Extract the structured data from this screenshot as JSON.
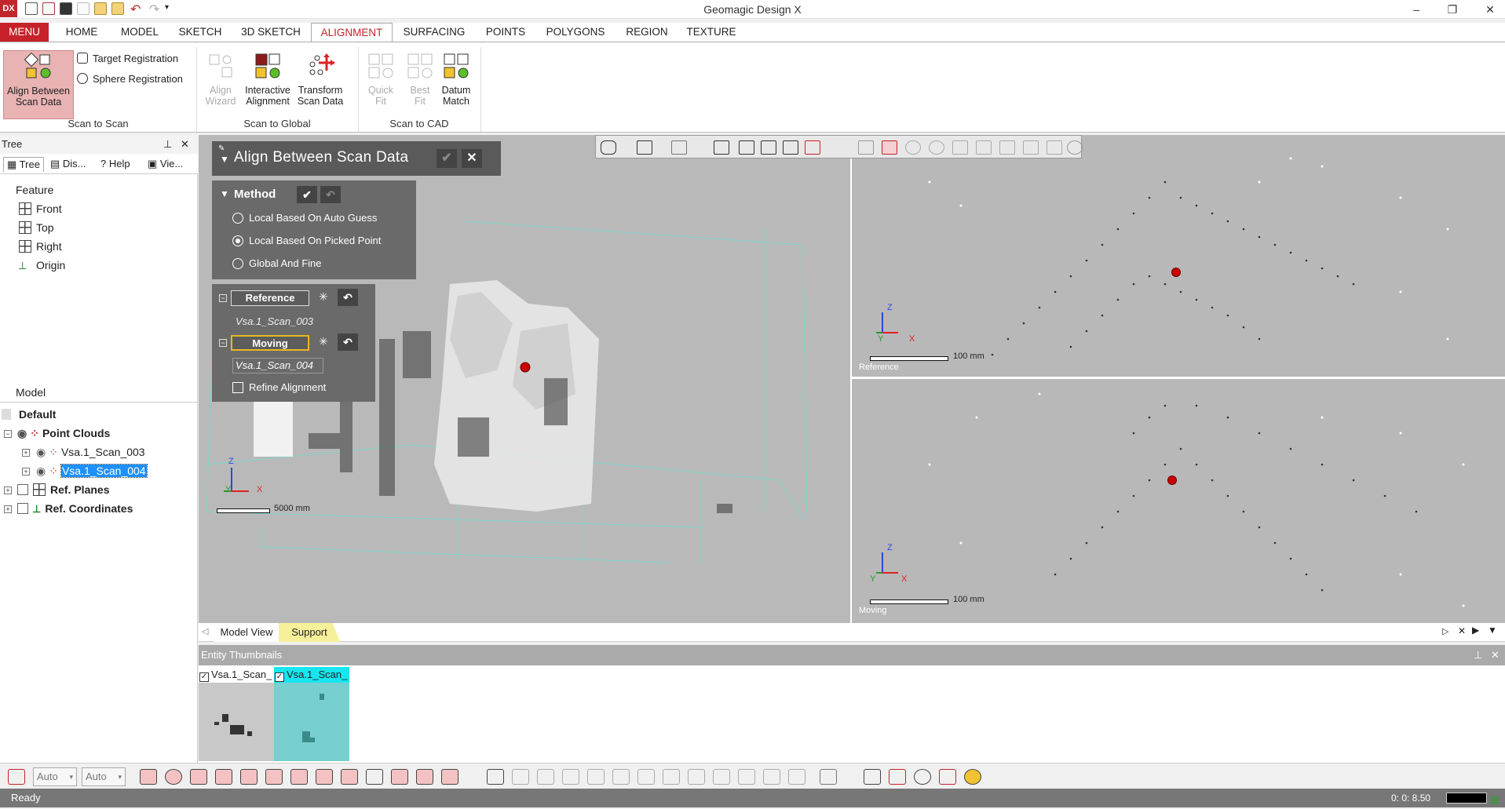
{
  "app": {
    "title": "Geomagic Design X",
    "logo_text": "DX"
  },
  "menu_tabs": [
    "MENU",
    "HOME",
    "MODEL",
    "SKETCH",
    "3D SKETCH",
    "ALIGNMENT",
    "SURFACING",
    "POINTS",
    "POLYGONS",
    "REGION",
    "TEXTURE"
  ],
  "ribbon": {
    "scan_to_scan": {
      "group_label": "Scan to Scan",
      "align_between": "Align Between\nScan Data",
      "target_registration": "Target Registration",
      "sphere_registration": "Sphere Registration"
    },
    "scan_to_global": {
      "group_label": "Scan to Global",
      "align_wizard": "Align\nWizard",
      "interactive_alignment": "Interactive\nAlignment",
      "transform_scan": "Transform\nScan Data"
    },
    "scan_to_cad": {
      "group_label": "Scan to CAD",
      "quick_fit": "Quick\nFit",
      "best_fit": "Best\nFit",
      "datum_match": "Datum\nMatch"
    }
  },
  "left_pane": {
    "header": "Tree",
    "tabs": [
      "Tree",
      "Dis...",
      "Help",
      "Vie..."
    ],
    "feature_label": "Feature",
    "features": [
      "Front",
      "Top",
      "Right",
      "Origin"
    ],
    "model_label": "Model",
    "default_label": "Default",
    "point_clouds": "Point Clouds",
    "scans": [
      "Vsa.1_Scan_003",
      "Vsa.1_Scan_004"
    ],
    "ref_planes": "Ref. Planes",
    "ref_coordinates": "Ref. Coordinates"
  },
  "dialog": {
    "title": "Align Between Scan Data",
    "method_label": "Method",
    "methods": [
      "Local Based On Auto Guess",
      "Local Based On Picked Point",
      "Global And Fine"
    ],
    "selected_method": 1,
    "reference_label": "Reference",
    "reference_value": "Vsa.1_Scan_003",
    "moving_label": "Moving",
    "moving_value": "Vsa.1_Scan_004",
    "refine_label": "Refine Alignment"
  },
  "viewport": {
    "main_scale": "5000 mm",
    "ref_scale": "100 mm",
    "moving_scale": "100 mm",
    "ref_label": "Reference",
    "moving_label": "Moving",
    "axes": {
      "z": "Z",
      "y": "Y",
      "x": "X"
    }
  },
  "bottom_tabs": [
    "Model View",
    "Support"
  ],
  "thumbnails": {
    "header": "Entity Thumbnails",
    "items": [
      "Vsa.1_Scan_",
      "Vsa.1_Scan_"
    ]
  },
  "bottom_toolbar": {
    "select1": "Auto",
    "select2": "Auto"
  },
  "status": {
    "text": "Ready",
    "time": "0: 0: 8.50"
  },
  "colors": {
    "accent": "#c72229",
    "selected": "#e9b3b3",
    "viewport": "#b9b9b9",
    "highlight": "#1e90ff"
  }
}
